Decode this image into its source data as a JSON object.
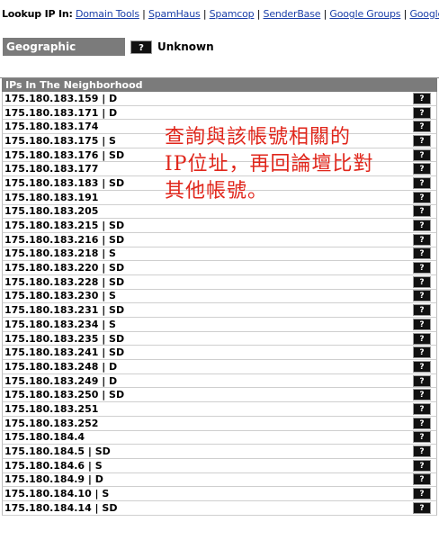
{
  "lookup": {
    "label": "Lookup IP In:",
    "links": [
      "Domain Tools",
      "SpamHaus",
      "Spamcop",
      "SenderBase",
      "Google Groups",
      "Google"
    ],
    "separator": "|"
  },
  "geo": {
    "label": "Geographic Location",
    "help": "?",
    "value": "Unknown"
  },
  "neighborhood": {
    "header": "IPs In The Neighborhood",
    "help": "?",
    "rows": [
      "175.180.183.159 | D",
      "175.180.183.171 | D",
      "175.180.183.174",
      "175.180.183.175 | S",
      "175.180.183.176 | SD",
      "175.180.183.177",
      "175.180.183.183 | SD",
      "175.180.183.191",
      "175.180.183.205",
      "175.180.183.215 | SD",
      "175.180.183.216 | SD",
      "175.180.183.218 | S",
      "175.180.183.220 | SD",
      "175.180.183.228 | SD",
      "175.180.183.230 | S",
      "175.180.183.231 | SD",
      "175.180.183.234 | S",
      "175.180.183.235 | SD",
      "175.180.183.241 | SD",
      "175.180.183.248 | D",
      "175.180.183.249 | D",
      "175.180.183.250 | SD",
      "175.180.183.251",
      "175.180.183.252",
      "175.180.184.4",
      "175.180.184.5 | SD",
      "175.180.184.6 | S",
      "175.180.184.9 | D",
      "175.180.184.10 | S",
      "175.180.184.14 | SD"
    ]
  },
  "annotation": {
    "lines": [
      "查詢與該帳號相關的",
      "IP位址，再回論壇比對",
      "其他帳號。"
    ],
    "color": "#e0261b"
  }
}
